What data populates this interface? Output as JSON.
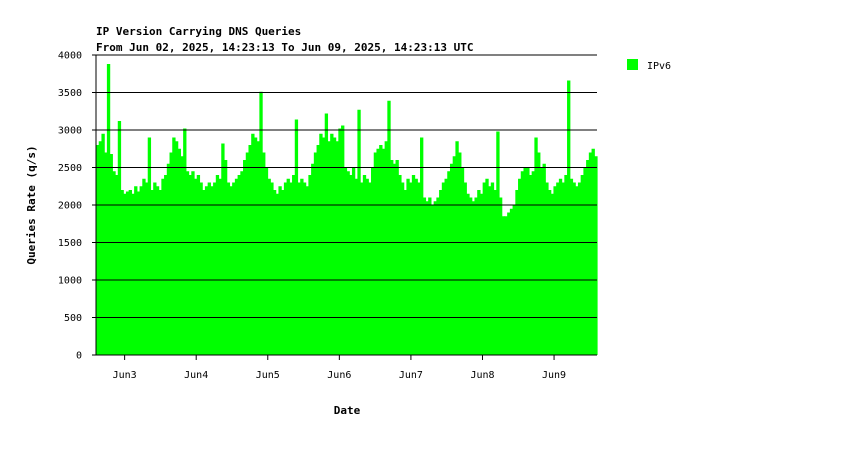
{
  "chart_data": {
    "type": "bar",
    "title": "IP Version Carrying DNS Queries",
    "subtitle": "From Jun 02, 2025, 14:23:13 To Jun 09, 2025, 14:23:13 UTC",
    "xlabel": "Date",
    "ylabel": "Queries Rate (q/s)",
    "ylim": [
      0,
      4000
    ],
    "yticks": [
      0,
      500,
      1000,
      1500,
      2000,
      2500,
      3000,
      3500,
      4000
    ],
    "xticks": [
      {
        "label": "Jun3",
        "day_offset": 0.4
      },
      {
        "label": "Jun4",
        "day_offset": 1.4
      },
      {
        "label": "Jun5",
        "day_offset": 2.4
      },
      {
        "label": "Jun6",
        "day_offset": 3.4
      },
      {
        "label": "Jun7",
        "day_offset": 4.4
      },
      {
        "label": "Jun8",
        "day_offset": 5.4
      },
      {
        "label": "Jun9",
        "day_offset": 6.4
      }
    ],
    "x_days": 7,
    "grid": true,
    "legend_position": "right",
    "series": [
      {
        "name": "IPv6",
        "color": "#00ff00",
        "values": [
          2800,
          2850,
          2950,
          2700,
          3880,
          2680,
          2450,
          2400,
          3120,
          2200,
          2150,
          2180,
          2200,
          2150,
          2250,
          2180,
          2250,
          2350,
          2300,
          2900,
          2200,
          2300,
          2250,
          2200,
          2350,
          2400,
          2550,
          2700,
          2900,
          2850,
          2750,
          2650,
          3020,
          2450,
          2400,
          2450,
          2350,
          2400,
          2300,
          2200,
          2250,
          2300,
          2250,
          2300,
          2400,
          2350,
          2820,
          2600,
          2300,
          2250,
          2300,
          2350,
          2400,
          2450,
          2600,
          2700,
          2800,
          2950,
          2900,
          2850,
          3510,
          2700,
          2500,
          2350,
          2300,
          2200,
          2150,
          2250,
          2200,
          2300,
          2350,
          2300,
          2400,
          3140,
          2300,
          2350,
          2300,
          2250,
          2400,
          2550,
          2700,
          2800,
          2950,
          2900,
          3220,
          2850,
          2950,
          2900,
          2850,
          3020,
          3060,
          2500,
          2450,
          2400,
          2500,
          2350,
          3270,
          2300,
          2400,
          2350,
          2300,
          2500,
          2700,
          2750,
          2800,
          2750,
          2850,
          3390,
          2600,
          2550,
          2600,
          2400,
          2300,
          2200,
          2350,
          2300,
          2400,
          2350,
          2300,
          2900,
          2100,
          2050,
          2100,
          2000,
          2050,
          2100,
          2200,
          2300,
          2350,
          2450,
          2550,
          2650,
          2850,
          2700,
          2500,
          2300,
          2150,
          2100,
          2050,
          2100,
          2200,
          2150,
          2300,
          2350,
          2250,
          2300,
          2200,
          2980,
          2100,
          1850,
          1850,
          1900,
          1950,
          2000,
          2200,
          2350,
          2450,
          2500,
          2500,
          2400,
          2450,
          2900,
          2700,
          2500,
          2550,
          2300,
          2200,
          2150,
          2250,
          2300,
          2350,
          2300,
          2400,
          3660,
          2350,
          2300,
          2250,
          2300,
          2400,
          2500,
          2600,
          2700,
          2750,
          2650
        ]
      }
    ]
  }
}
